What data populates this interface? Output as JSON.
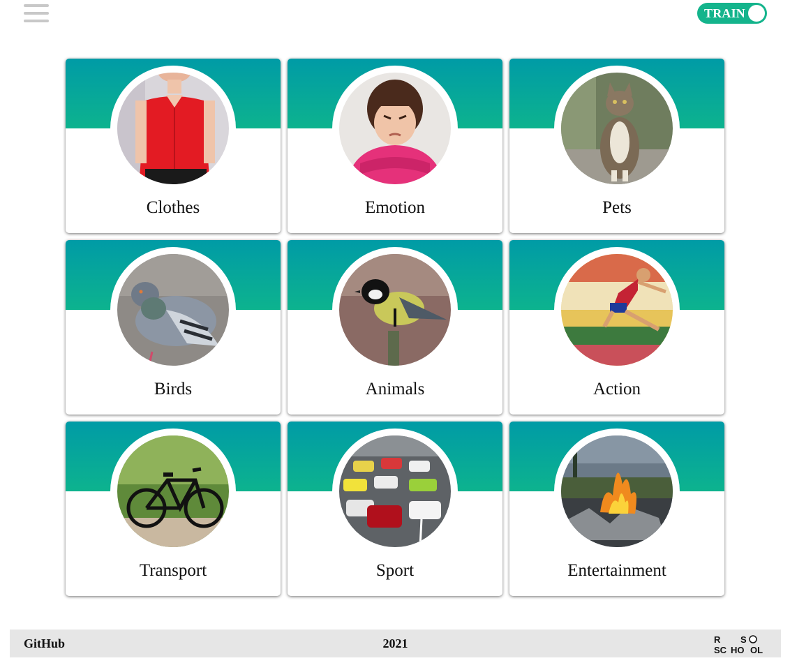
{
  "header": {
    "menu_icon": "hamburger-icon",
    "mode_toggle": {
      "label": "TRAIN",
      "state": "train",
      "color": "#14b48c"
    }
  },
  "categories": [
    {
      "title": "Clothes",
      "image": "woman-red-blouse"
    },
    {
      "title": "Emotion",
      "image": "angry-girl"
    },
    {
      "title": "Pets",
      "image": "cat"
    },
    {
      "title": "Birds",
      "image": "pigeon"
    },
    {
      "title": "Animals",
      "image": "titmouse-bird"
    },
    {
      "title": "Action",
      "image": "long-jump-athlete"
    },
    {
      "title": "Transport",
      "image": "bicycle"
    },
    {
      "title": "Sport",
      "image": "race-cars"
    },
    {
      "title": "Entertainment",
      "image": "campfire"
    }
  ],
  "footer": {
    "github_label": "GitHub",
    "year": "2021",
    "logo": "rs-school-logo",
    "logo_letters": [
      "R",
      "S",
      "SC",
      "HO",
      "OL"
    ]
  },
  "colors": {
    "card_gradient_top": "#009ba6",
    "card_gradient_bottom": "#0db38e",
    "footer_bg": "#e6e6e6"
  }
}
